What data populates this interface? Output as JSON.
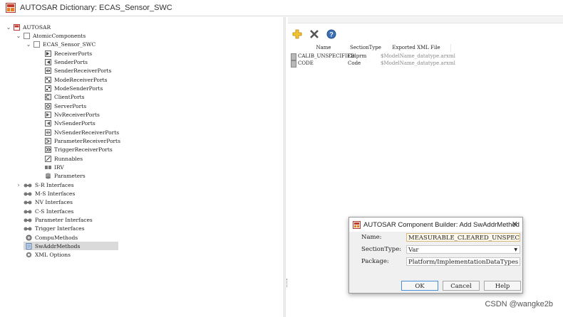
{
  "window": {
    "title": "AUTOSAR Dictionary: ECAS_Sensor_SWC"
  },
  "tree": {
    "root": "AUTOSAR",
    "atomic": "AtomicComponents",
    "component": "ECAS_Sensor_SWC",
    "children": [
      {
        "label": "ReceiverPorts",
        "icon": "receiver-port-icon"
      },
      {
        "label": "SenderPorts",
        "icon": "sender-port-icon"
      },
      {
        "label": "SenderReceiverPorts",
        "icon": "sender-receiver-port-icon"
      },
      {
        "label": "ModeReceiverPorts",
        "icon": "mode-receiver-port-icon"
      },
      {
        "label": "ModeSenderPorts",
        "icon": "mode-sender-port-icon"
      },
      {
        "label": "ClientPorts",
        "icon": "client-port-icon"
      },
      {
        "label": "ServerPorts",
        "icon": "server-port-icon"
      },
      {
        "label": "NvReceiverPorts",
        "icon": "nv-receiver-port-icon"
      },
      {
        "label": "NvSenderPorts",
        "icon": "nv-sender-port-icon"
      },
      {
        "label": "NvSenderReceiverPorts",
        "icon": "nv-sender-receiver-port-icon"
      },
      {
        "label": "ParameterReceiverPorts",
        "icon": "parameter-receiver-port-icon"
      },
      {
        "label": "TriggerReceiverPorts",
        "icon": "trigger-receiver-port-icon"
      },
      {
        "label": "Runnables",
        "icon": "runnables-icon"
      },
      {
        "label": "IRV",
        "icon": "irv-icon"
      },
      {
        "label": "Parameters",
        "icon": "parameters-icon"
      }
    ],
    "interfaces": [
      {
        "label": "S-R Interfaces",
        "expandable": true
      },
      {
        "label": "M-S Interfaces",
        "expandable": false
      },
      {
        "label": "NV Interfaces",
        "expandable": false
      },
      {
        "label": "C-S Interfaces",
        "expandable": false
      },
      {
        "label": "Parameter Interfaces",
        "expandable": false
      },
      {
        "label": "Trigger Interfaces",
        "expandable": false
      }
    ],
    "compu_methods": "CompuMethods",
    "sw_addr_methods": "SwAddrMethods",
    "xml_options": "XML Options"
  },
  "table": {
    "headers": [
      "Name",
      "SectionType",
      "Exported XML File"
    ],
    "rows": [
      {
        "name": "CALIB_UNSPECIFIED",
        "section": "Calprm",
        "file": "$ModelName_datatype.arxml"
      },
      {
        "name": "CODE",
        "section": "Code",
        "file": "$ModelName_datatype.arxml"
      }
    ]
  },
  "dialog": {
    "title": "AUTOSAR Component Builder: Add SwAddrMethod",
    "name_label": "Name:",
    "name_value": "MEASURABLE_CLEARED_UNSPECIFIED",
    "section_label": "SectionType:",
    "section_value": "Var",
    "package_label": "Package:",
    "package_value": "Platform/ImplementationDataTypes",
    "ok": "OK",
    "cancel": "Cancel",
    "help": "Help"
  },
  "watermark": "CSDN @wangke2b",
  "colors": {
    "selection": "#dadada",
    "focus_border": "#d7b87f",
    "default_button": "#4a90d9"
  }
}
